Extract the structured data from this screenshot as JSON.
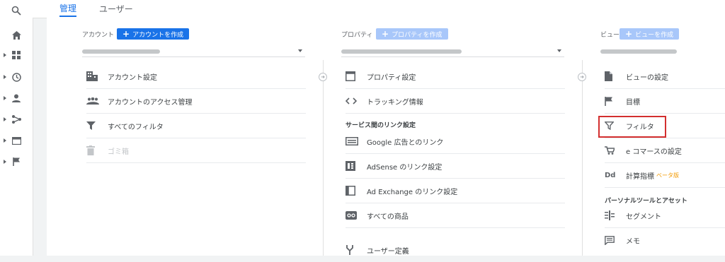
{
  "tabs": {
    "admin": "管理",
    "user": "ユーザー"
  },
  "account": {
    "header": "アカウント",
    "create": "アカウントを作成",
    "items": [
      "アカウント設定",
      "アカウントのアクセス管理",
      "すべてのフィルタ",
      "ゴミ箱"
    ]
  },
  "property": {
    "header": "プロパティ",
    "create": "プロパティを作成",
    "items": [
      "プロパティ設定",
      "トラッキング情報"
    ],
    "section": "サービス間のリンク設定",
    "links": [
      "Google 広告とのリンク",
      "AdSense のリンク設定",
      "Ad Exchange のリンク設定",
      "すべての商品"
    ],
    "more": "ユーザー定義"
  },
  "view": {
    "header": "ビュー",
    "create": "ビューを作成",
    "items": [
      "ビューの設定",
      "目標",
      "フィルタ",
      "e コマースの設定",
      "計算指標"
    ],
    "beta": "ベータ版",
    "dd": "Dd",
    "section": "パーソナルツールとアセット",
    "tools": [
      "セグメント",
      "メモ"
    ]
  }
}
